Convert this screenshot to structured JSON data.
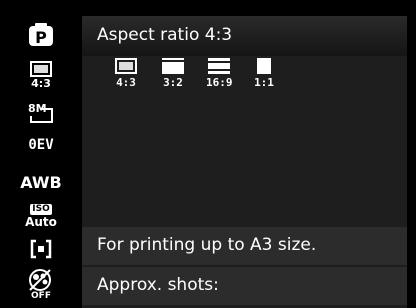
{
  "sidebar": {
    "mode_icon": "program-mode-icon",
    "mode_letter": "P",
    "aspect_label": "4:3",
    "size_label": "8M",
    "ev_label": "0EV",
    "wb_label": "AWB",
    "iso_top": "ISO",
    "iso_bottom": "Auto",
    "metering_icon": "spot-metering-icon",
    "color_off_label": "OFF"
  },
  "panel": {
    "title": "Aspect ratio 4:3",
    "options": [
      {
        "label": "4:3",
        "icon": "ratio-4-3-icon",
        "selected": true
      },
      {
        "label": "3:2",
        "icon": "ratio-3-2-icon",
        "selected": false
      },
      {
        "label": "16:9",
        "icon": "ratio-16-9-icon",
        "selected": false
      },
      {
        "label": "1:1",
        "icon": "ratio-1-1-icon",
        "selected": false
      }
    ],
    "description": "For printing up to A3 size.",
    "shots_label": "Approx. shots:"
  }
}
